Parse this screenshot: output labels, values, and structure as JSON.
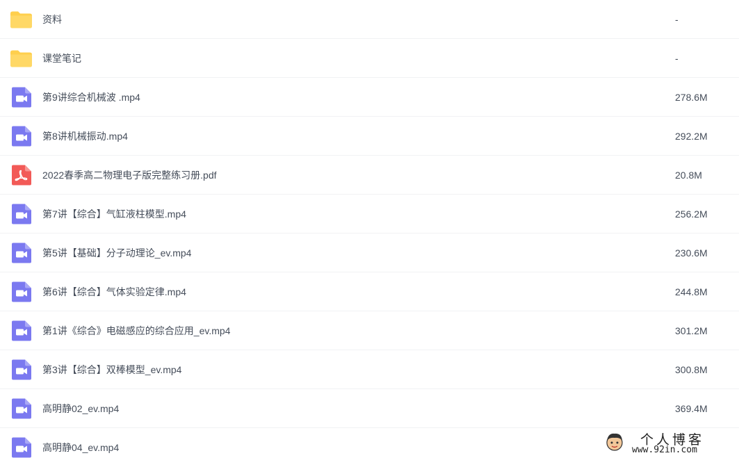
{
  "files": [
    {
      "name": "资料",
      "size": "-",
      "type": "folder",
      "icon": "folder-icon"
    },
    {
      "name": "课堂笔记",
      "size": "-",
      "type": "folder",
      "icon": "folder-icon"
    },
    {
      "name": "第9讲综合机械波 .mp4",
      "size": "278.6M",
      "type": "video",
      "icon": "video-icon"
    },
    {
      "name": "第8讲机械振动.mp4",
      "size": "292.2M",
      "type": "video",
      "icon": "video-icon"
    },
    {
      "name": "2022春季高二物理电子版完整练习册.pdf",
      "size": "20.8M",
      "type": "pdf",
      "icon": "pdf-icon"
    },
    {
      "name": "第7讲【综合】气缸液柱模型.mp4",
      "size": "256.2M",
      "type": "video",
      "icon": "video-icon"
    },
    {
      "name": "第5讲【基础】分子动理论_ev.mp4",
      "size": "230.6M",
      "type": "video",
      "icon": "video-icon"
    },
    {
      "name": "第6讲【综合】气体实验定律.mp4",
      "size": "244.8M",
      "type": "video",
      "icon": "video-icon"
    },
    {
      "name": "第1讲《综合》电磁感应的综合应用_ev.mp4",
      "size": "301.2M",
      "type": "video",
      "icon": "video-icon"
    },
    {
      "name": "第3讲【综合】双棒模型_ev.mp4",
      "size": "300.8M",
      "type": "video",
      "icon": "video-icon"
    },
    {
      "name": "高明静02_ev.mp4",
      "size": "369.4M",
      "type": "video",
      "icon": "video-icon"
    },
    {
      "name": "高明静04_ev.mp4",
      "size": "",
      "type": "video",
      "icon": "video-icon"
    }
  ],
  "colors": {
    "folder": "#ffcf4d",
    "video": "#7b79f0",
    "pdf": "#f25a57",
    "text": "#454d5a",
    "divider": "#f1f2f4"
  },
  "watermark": {
    "title": "个人博客",
    "url": "www.92in.com"
  }
}
